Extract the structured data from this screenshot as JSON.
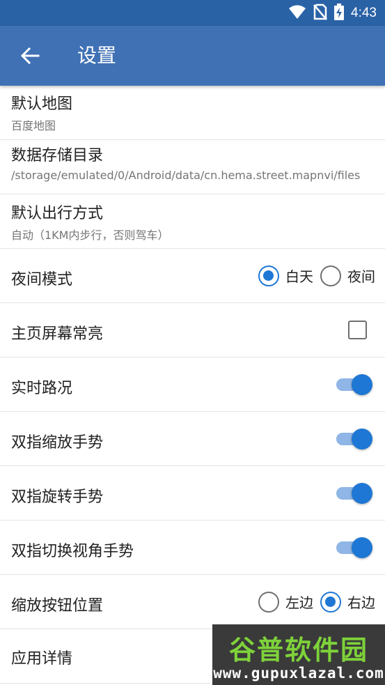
{
  "status_bar": {
    "time": "4:43",
    "icons": [
      "wifi-icon",
      "no-sim-icon",
      "battery-charging-icon"
    ]
  },
  "app_bar": {
    "title": "设置",
    "back_icon": "arrow-left-icon"
  },
  "settings": {
    "default_map": {
      "title": "默认地图",
      "value": "百度地图"
    },
    "storage_dir": {
      "title": "数据存储目录",
      "value": "/storage/emulated/0/Android/data/cn.hema.street.mapnvi/files"
    },
    "travel_mode": {
      "title": "默认出行方式",
      "value": "自动（1KM内步行，否则驾车）"
    },
    "night_mode": {
      "title": "夜间模式",
      "options": [
        {
          "label": "白天",
          "selected": true
        },
        {
          "label": "夜间",
          "selected": false
        }
      ]
    },
    "screen_on": {
      "title": "主页屏幕常亮",
      "checked": false
    },
    "traffic": {
      "title": "实时路况",
      "on": true
    },
    "pinch_zoom": {
      "title": "双指缩放手势",
      "on": true
    },
    "rotate": {
      "title": "双指旋转手势",
      "on": true
    },
    "tilt": {
      "title": "双指切换视角手势",
      "on": true
    },
    "zoom_button": {
      "title": "缩放按钮位置",
      "options": [
        {
          "label": "左边",
          "selected": false
        },
        {
          "label": "右边",
          "selected": true
        }
      ]
    },
    "app_details": {
      "title": "应用详情"
    }
  },
  "watermark": {
    "title": "谷普软件园",
    "url": "www.gupuxlazal.com"
  },
  "colors": {
    "status_bar": "#2a62a6",
    "app_bar": "#3f71b4",
    "accent": "#1e77d4"
  }
}
